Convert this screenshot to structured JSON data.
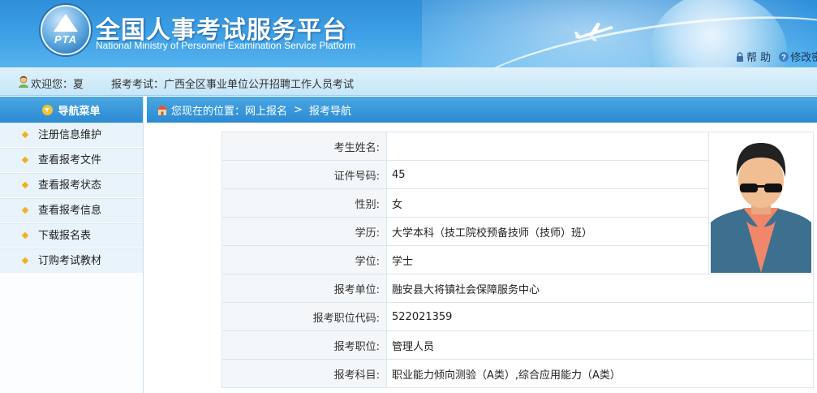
{
  "banner": {
    "title": "全国人事考试服务平台",
    "subtitle": "National Ministry of Personnel Examination Service Platform",
    "logo_text": "PTA",
    "help_label": "帮 助",
    "modify_label": "修改密码"
  },
  "infobar": {
    "welcome": "欢迎您：夏",
    "exam": "报考考试：广西全区事业单位公开招聘工作人员考试"
  },
  "sidebar": {
    "title": "导航菜单",
    "items": [
      {
        "label": "注册信息维护"
      },
      {
        "label": "查看报考文件"
      },
      {
        "label": "查看报考状态"
      },
      {
        "label": "查看报考信息"
      },
      {
        "label": "下载报名表"
      },
      {
        "label": "订购考试教材"
      }
    ]
  },
  "breadcrumb": {
    "prefix": "您现在的位置：",
    "level1": "网上报名",
    "separator": ">",
    "level2": "报考导航"
  },
  "form": {
    "rows": [
      {
        "label": "考生姓名:",
        "value": ""
      },
      {
        "label": "证件号码:",
        "value": "45"
      },
      {
        "label": "性别:",
        "value": "女"
      },
      {
        "label": "学历:",
        "value": "大学本科（技工院校预备技师（技师）班）"
      },
      {
        "label": "学位:",
        "value": "学士"
      },
      {
        "label": "报考单位:",
        "value": "融安县大将镇社会保障服务中心"
      },
      {
        "label": "报考职位代码:",
        "value": "522021359"
      },
      {
        "label": "报考职位:",
        "value": "管理人员"
      },
      {
        "label": "报考科目:",
        "value": "职业能力倾向测验（A类）,综合应用能力（A类）"
      }
    ]
  },
  "colors": {
    "banner_blue": "#3fa1e6",
    "nav_blue": "#2b8ad2",
    "menu_bg": "#e8f3fb",
    "bullet": "#f2b01e"
  },
  "icons": [
    "lock-icon",
    "help-icon",
    "user-icon",
    "down-arrow-icon",
    "home-icon",
    "airplane-icon",
    "avatar-photo"
  ]
}
